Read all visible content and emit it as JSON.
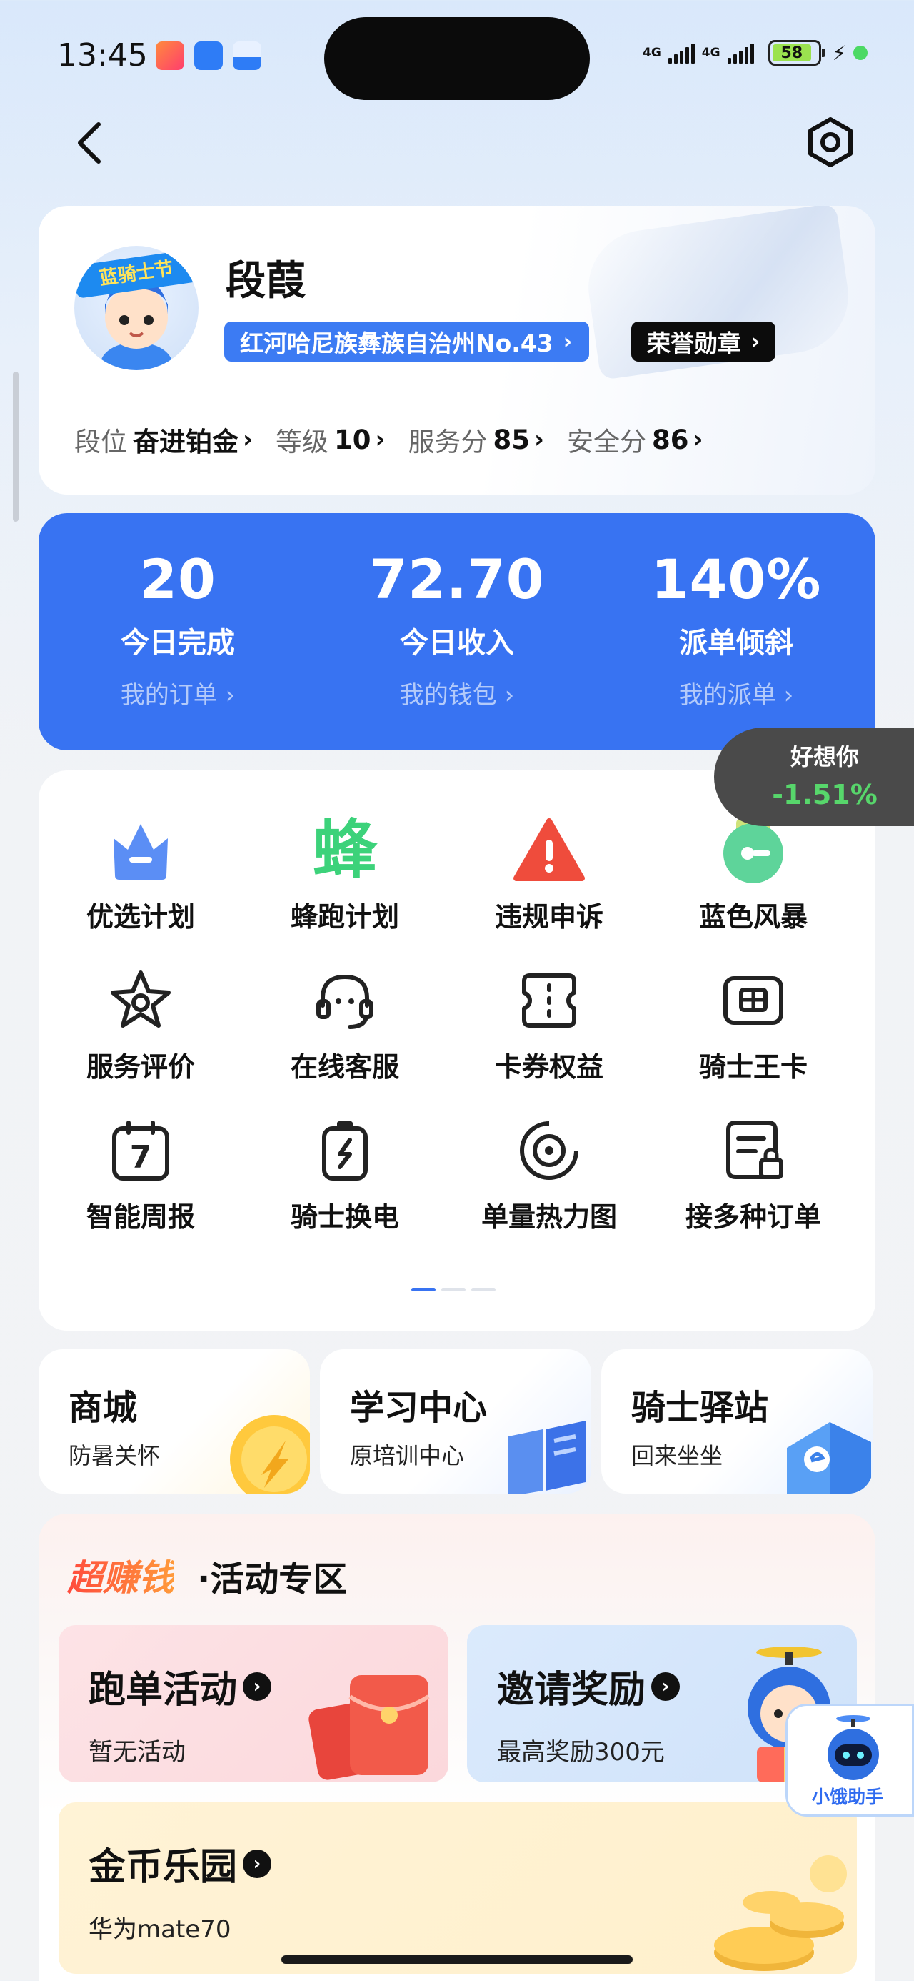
{
  "status": {
    "time": "13:45",
    "net1": "4G",
    "net2": "4G",
    "battery": "58",
    "battery_level": 0.58
  },
  "profile": {
    "name": "段葭",
    "region": "红河哈尼族彝族自治州No.43",
    "honor": "荣誉勋章",
    "avatar_badge": "蓝骑士节",
    "stats": [
      {
        "label": "段位",
        "value": "奋进铂金"
      },
      {
        "label": "等级",
        "value": "10"
      },
      {
        "label": "服务分",
        "value": "85"
      },
      {
        "label": "安全分",
        "value": "86"
      }
    ]
  },
  "metrics": [
    {
      "value": "20",
      "label": "今日完成",
      "link": "我的订单"
    },
    {
      "value": "72.70",
      "label": "今日收入",
      "link": "我的钱包"
    },
    {
      "value": "140%",
      "label": "派单倾斜",
      "link": "我的派单"
    }
  ],
  "floating_quote": {
    "title": "好想你",
    "change": "-1.51%",
    "color": "#57d66b"
  },
  "grid": [
    {
      "label": "优选计划",
      "icon": "crown-icon"
    },
    {
      "label": "蜂跑计划",
      "icon": "bee-icon",
      "glyph": "蜂"
    },
    {
      "label": "违规申诉",
      "icon": "warning-icon"
    },
    {
      "label": "蓝色风暴",
      "icon": "key-icon"
    },
    {
      "label": "服务评价",
      "icon": "star-icon"
    },
    {
      "label": "在线客服",
      "icon": "headset-icon"
    },
    {
      "label": "卡券权益",
      "icon": "coupon-icon"
    },
    {
      "label": "骑士王卡",
      "icon": "card-icon"
    },
    {
      "label": "智能周报",
      "icon": "calendar-icon",
      "glyph": "7"
    },
    {
      "label": "骑士换电",
      "icon": "battery-swap-icon"
    },
    {
      "label": "单量热力图",
      "icon": "heatmap-icon"
    },
    {
      "label": "接多种订单",
      "icon": "order-types-icon"
    }
  ],
  "mini_cards": [
    {
      "title": "商城",
      "sub": "防暑关怀"
    },
    {
      "title": "学习中心",
      "sub": "原培训中心"
    },
    {
      "title": "骑士驿站",
      "sub": "回来坐坐"
    }
  ],
  "zone": {
    "title_a": "超赚钱",
    "title_b": "·活动专区",
    "cards": [
      {
        "title": "跑单活动",
        "sub": "暂无活动"
      },
      {
        "title": "邀请奖励",
        "sub": "最高奖励300元"
      },
      {
        "title": "金币乐园",
        "sub": "华为mate70"
      }
    ]
  },
  "assistant": {
    "label": "小饿助手"
  },
  "colors": {
    "primary": "#3873f2",
    "honor_bg": "#0c0c0c",
    "accent_green": "#4cd964"
  }
}
